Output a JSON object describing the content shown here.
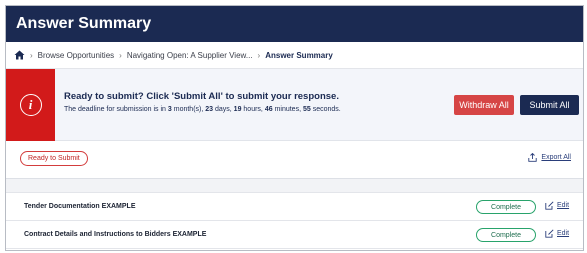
{
  "header": {
    "title": "Answer Summary"
  },
  "breadcrumb": {
    "items": [
      "Browse Opportunities",
      "Navigating Open: A Supplier View...",
      "Answer Summary"
    ]
  },
  "alert": {
    "heading": "Ready to submit? Click 'Submit All' to submit your response.",
    "deadline_prefix": "The deadline for submission is in ",
    "months": "3",
    "months_unit": " month(s), ",
    "days": "23",
    "days_unit": " days, ",
    "hours": "19",
    "hours_unit": " hours, ",
    "minutes": "46",
    "minutes_unit": " minutes, ",
    "seconds": "55",
    "seconds_unit": " seconds.",
    "withdraw_label": "Withdraw All",
    "submit_label": "Submit All"
  },
  "status": {
    "badge": "Ready to Submit",
    "export_label": "Export All"
  },
  "rows": [
    {
      "title": "Tender Documentation EXAMPLE",
      "status": "Complete",
      "edit": "Edit"
    },
    {
      "title": "Contract Details and Instructions to Bidders EXAMPLE",
      "status": "Complete",
      "edit": "Edit"
    }
  ],
  "colors": {
    "navy": "#1b2a52",
    "alert_red": "#d21a1a",
    "complete_green": "#28a36b"
  },
  "icons": {
    "home": "home-icon",
    "info": "info-icon",
    "export": "export-icon",
    "edit": "edit-icon"
  }
}
